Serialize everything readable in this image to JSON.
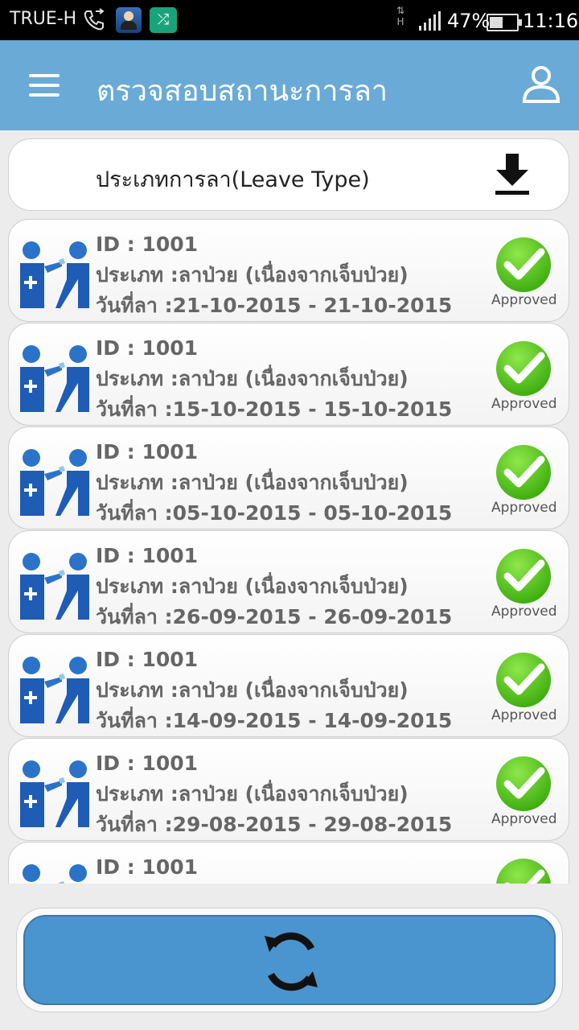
{
  "status_bar": {
    "carrier": "TRUE-H",
    "network": "H",
    "battery": "47%",
    "battery_level": 0.47,
    "time": "11:16",
    "icons": [
      "phone-call-icon",
      "contact-app-icon",
      "shuffle-app-icon",
      "signal-icon",
      "battery-icon"
    ]
  },
  "appbar": {
    "title": "ตรวจสอบสถานะการลา",
    "menu_icon": "hamburger-menu-icon",
    "profile_icon": "user-profile-icon"
  },
  "filter": {
    "label": "ประเภทการลา(Leave Type)",
    "icon": "download-icon"
  },
  "leave_items": [
    {
      "id_text": "ID : 1001",
      "type_text": "ประเภท :ลาป่วย (เนื่องจากเจ็บป่วย)",
      "date_text": "วันที่ลา :21-10-2015 - 21-10-2015",
      "status": "Approved"
    },
    {
      "id_text": "ID : 1001",
      "type_text": "ประเภท :ลาป่วย (เนื่องจากเจ็บป่วย)",
      "date_text": "วันที่ลา :15-10-2015 - 15-10-2015",
      "status": "Approved"
    },
    {
      "id_text": "ID : 1001",
      "type_text": "ประเภท :ลาป่วย (เนื่องจากเจ็บป่วย)",
      "date_text": "วันที่ลา :05-10-2015 - 05-10-2015",
      "status": "Approved"
    },
    {
      "id_text": "ID : 1001",
      "type_text": "ประเภท :ลาป่วย (เนื่องจากเจ็บป่วย)",
      "date_text": "วันที่ลา :26-09-2015 - 26-09-2015",
      "status": "Approved"
    },
    {
      "id_text": "ID : 1001",
      "type_text": "ประเภท :ลาป่วย (เนื่องจากเจ็บป่วย)",
      "date_text": "วันที่ลา :14-09-2015 - 14-09-2015",
      "status": "Approved"
    },
    {
      "id_text": "ID : 1001",
      "type_text": "ประเภท :ลาป่วย (เนื่องจากเจ็บป่วย)",
      "date_text": "วันที่ลา :29-08-2015 - 29-08-2015",
      "status": "Approved"
    },
    {
      "id_text": "ID : 1001",
      "type_text": "",
      "date_text": "",
      "status": ""
    }
  ],
  "item_icons": {
    "leave": "sick-leave-doctor-icon",
    "status": "approved-check-icon"
  },
  "refresh": {
    "icon": "refresh-icon"
  },
  "colors": {
    "appbar": "#6aaad6",
    "refresh_button": "#4a95cf",
    "approved_green": "#5ccc1a",
    "icon_blue": "#2a73c9"
  }
}
